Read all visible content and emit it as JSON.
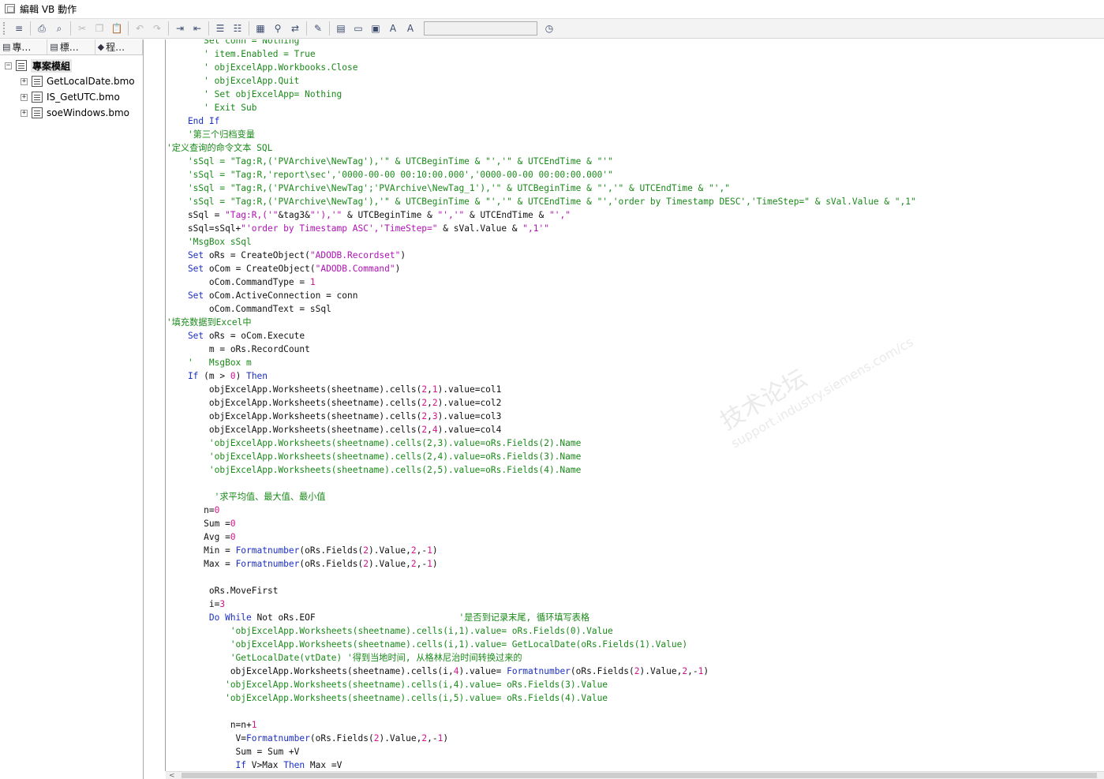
{
  "window": {
    "title": "編輯 VB 動作"
  },
  "toolbar": {
    "buttons": [
      {
        "name": "format-button",
        "icon": "≡"
      },
      {
        "name": "print-button",
        "icon": "⎙"
      },
      {
        "name": "print-preview-button",
        "icon": "⌕"
      },
      {
        "name": "cut-button",
        "icon": "✂"
      },
      {
        "name": "copy-button",
        "icon": "❐"
      },
      {
        "name": "paste-button",
        "icon": "📋"
      },
      {
        "name": "undo-button",
        "icon": "↶"
      },
      {
        "name": "redo-button",
        "icon": "↷"
      },
      {
        "name": "indent-button",
        "icon": "⇥"
      },
      {
        "name": "outdent-button",
        "icon": "⇤"
      },
      {
        "name": "comment-button",
        "icon": "☰"
      },
      {
        "name": "uncomment-button",
        "icon": "☷"
      },
      {
        "name": "bookmark-button",
        "icon": "▦"
      },
      {
        "name": "find-button",
        "icon": "⚲"
      },
      {
        "name": "replace-button",
        "icon": "⇄"
      },
      {
        "name": "breakpoint-button",
        "icon": "✎"
      },
      {
        "name": "compile-button",
        "icon": "▤"
      },
      {
        "name": "open-folder-button",
        "icon": "▭"
      },
      {
        "name": "new-folder-button",
        "icon": "▣"
      },
      {
        "name": "font-button",
        "icon": "A"
      },
      {
        "name": "text-button",
        "icon": "A"
      },
      {
        "name": "clock-button",
        "icon": "◷"
      }
    ]
  },
  "sidebar": {
    "tabs": [
      {
        "label": "專…",
        "icon": "▤"
      },
      {
        "label": "標…",
        "icon": "▤"
      },
      {
        "label": "程…",
        "icon": "◆"
      }
    ],
    "root": "專案模組",
    "items": [
      "GetLocalDate.bmo",
      "IS_GetUTC.bmo",
      "soeWindows.bmo"
    ]
  },
  "editor": {
    "lines": [
      [
        [
          "cm",
          "       Set conn = Nothing"
        ]
      ],
      [
        [
          "cm",
          "       ' item.Enabled = True"
        ]
      ],
      [
        [
          "cm",
          "       ' objExcelApp.Workbooks.Close"
        ]
      ],
      [
        [
          "cm",
          "       ' objExcelApp.Quit"
        ]
      ],
      [
        [
          "cm",
          "       ' Set objExcelApp= Nothing"
        ]
      ],
      [
        [
          "cm",
          "       ' Exit Sub"
        ]
      ],
      [
        [
          "kw",
          "    End If"
        ]
      ],
      [
        [
          "cm",
          "    '第三个归档变量"
        ]
      ],
      [
        [
          "cm",
          "'定义查询的命令文本 SQL"
        ]
      ],
      [
        [
          "cm",
          "    'sSql = \"Tag:R,('PVArchive\\NewTag'),'\" & UTCBeginTime & \"','\" & UTCEndTime & \"'\""
        ]
      ],
      [
        [
          "cm",
          "    'sSql = \"Tag:R,'report\\sec','0000-00-00 00:10:00.000','0000-00-00 00:00:00.000'\""
        ]
      ],
      [
        [
          "cm",
          "    'sSql = \"Tag:R,('PVArchive\\NewTag';'PVArchive\\NewTag_1'),'\" & UTCBeginTime & \"','\" & UTCEndTime & \"',\""
        ]
      ],
      [
        [
          "cm",
          "    'sSql = \"Tag:R,('PVArchive\\NewTag'),'\" & UTCBeginTime & \"','\" & UTCEndTime & \"','order by Timestamp DESC','TimeStep=\" & sVal.Value & \",1\""
        ]
      ],
      [
        [
          "id",
          "    sSql = "
        ],
        [
          "str",
          "\"Tag:R,('\""
        ],
        [
          "id",
          "&tag3&"
        ],
        [
          "str",
          "\"'),'\""
        ],
        [
          "id",
          " & UTCBeginTime & "
        ],
        [
          "str",
          "\"','\""
        ],
        [
          "id",
          " & UTCEndTime & "
        ],
        [
          "str",
          "\"',\""
        ]
      ],
      [
        [
          "id",
          "    sSql=sSql+"
        ],
        [
          "str",
          "\"'order by Timestamp ASC','TimeStep=\""
        ],
        [
          "id",
          " & sVal.Value & "
        ],
        [
          "str",
          "\",1'\""
        ]
      ],
      [
        [
          "cm",
          "    'MsgBox sSql"
        ]
      ],
      [
        [
          "kw",
          "    Set"
        ],
        [
          "id",
          " oRs = CreateObject("
        ],
        [
          "str",
          "\"ADODB.Recordset\""
        ],
        [
          "id",
          ")"
        ]
      ],
      [
        [
          "kw",
          "    Set"
        ],
        [
          "id",
          " oCom = CreateObject("
        ],
        [
          "str",
          "\"ADODB.Command\""
        ],
        [
          "id",
          ")"
        ]
      ],
      [
        [
          "id",
          "        oCom.CommandType = "
        ],
        [
          "num",
          "1"
        ]
      ],
      [
        [
          "kw",
          "    Set"
        ],
        [
          "id",
          " oCom.ActiveConnection = conn"
        ]
      ],
      [
        [
          "id",
          "        oCom.CommandText = sSql"
        ]
      ],
      [
        [
          "cm",
          "'填充数据到Excel中"
        ]
      ],
      [
        [
          "kw",
          "    Set"
        ],
        [
          "id",
          " oRs = oCom.Execute"
        ]
      ],
      [
        [
          "id",
          "        m = oRs.RecordCount"
        ]
      ],
      [
        [
          "cm",
          "    '   MsgBox m"
        ]
      ],
      [
        [
          "kw",
          "    If"
        ],
        [
          "id",
          " (m > "
        ],
        [
          "num",
          "0"
        ],
        [
          "id",
          ") "
        ],
        [
          "kw",
          "Then"
        ]
      ],
      [
        [
          "id",
          "        objExcelApp.Worksheets(sheetname).cells("
        ],
        [
          "num",
          "2"
        ],
        [
          "id",
          ","
        ],
        [
          "num",
          "1"
        ],
        [
          "id",
          ").value=col1"
        ]
      ],
      [
        [
          "id",
          "        objExcelApp.Worksheets(sheetname).cells("
        ],
        [
          "num",
          "2"
        ],
        [
          "id",
          ","
        ],
        [
          "num",
          "2"
        ],
        [
          "id",
          ").value=col2"
        ]
      ],
      [
        [
          "id",
          "        objExcelApp.Worksheets(sheetname).cells("
        ],
        [
          "num",
          "2"
        ],
        [
          "id",
          ","
        ],
        [
          "num",
          "3"
        ],
        [
          "id",
          ").value=col3"
        ]
      ],
      [
        [
          "id",
          "        objExcelApp.Worksheets(sheetname).cells("
        ],
        [
          "num",
          "2"
        ],
        [
          "id",
          ","
        ],
        [
          "num",
          "4"
        ],
        [
          "id",
          ").value=col4"
        ]
      ],
      [
        [
          "cm",
          "        'objExcelApp.Worksheets(sheetname).cells(2,3).value=oRs.Fields(2).Name"
        ]
      ],
      [
        [
          "cm",
          "        'objExcelApp.Worksheets(sheetname).cells(2,4).value=oRs.Fields(3).Name"
        ]
      ],
      [
        [
          "cm",
          "        'objExcelApp.Worksheets(sheetname).cells(2,5).value=oRs.Fields(4).Name"
        ]
      ],
      [
        [
          "id",
          ""
        ]
      ],
      [
        [
          "cm",
          "         '求平均值、最大值、最小值"
        ]
      ],
      [
        [
          "id",
          "       n="
        ],
        [
          "num",
          "0"
        ]
      ],
      [
        [
          "id",
          "       Sum ="
        ],
        [
          "num",
          "0"
        ]
      ],
      [
        [
          "id",
          "       Avg ="
        ],
        [
          "num",
          "0"
        ]
      ],
      [
        [
          "id",
          "       Min = "
        ],
        [
          "kw",
          "Formatnumber"
        ],
        [
          "id",
          "(oRs.Fields("
        ],
        [
          "num",
          "2"
        ],
        [
          "id",
          ").Value,"
        ],
        [
          "num",
          "2"
        ],
        [
          "id",
          ",-"
        ],
        [
          "num",
          "1"
        ],
        [
          "id",
          ")"
        ]
      ],
      [
        [
          "id",
          "       Max = "
        ],
        [
          "kw",
          "Formatnumber"
        ],
        [
          "id",
          "(oRs.Fields("
        ],
        [
          "num",
          "2"
        ],
        [
          "id",
          ").Value,"
        ],
        [
          "num",
          "2"
        ],
        [
          "id",
          ",-"
        ],
        [
          "num",
          "1"
        ],
        [
          "id",
          ")"
        ]
      ],
      [
        [
          "id",
          ""
        ]
      ],
      [
        [
          "id",
          "        oRs.MoveFirst"
        ]
      ],
      [
        [
          "id",
          "        i="
        ],
        [
          "num",
          "3"
        ]
      ],
      [
        [
          "kw",
          "        Do While"
        ],
        [
          "id",
          " Not oRs.EOF                           "
        ],
        [
          "cm",
          "'是否到记录末尾, 循环填写表格"
        ]
      ],
      [
        [
          "cm",
          "            'objExcelApp.Worksheets(sheetname).cells(i,1).value= oRs.Fields(0).Value"
        ]
      ],
      [
        [
          "cm",
          "            'objExcelApp.Worksheets(sheetname).cells(i,1).value= GetLocalDate(oRs.Fields(1).Value)"
        ]
      ],
      [
        [
          "cm",
          "            'GetLocalDate(vtDate) '得到当地时间, 从格林尼治时间转换过来的"
        ]
      ],
      [
        [
          "id",
          "            objExcelApp.Worksheets(sheetname).cells(i,"
        ],
        [
          "num",
          "4"
        ],
        [
          "id",
          ").value= "
        ],
        [
          "kw",
          "Formatnumber"
        ],
        [
          "id",
          "(oRs.Fields("
        ],
        [
          "num",
          "2"
        ],
        [
          "id",
          ").Value,"
        ],
        [
          "num",
          "2"
        ],
        [
          "id",
          ",-"
        ],
        [
          "num",
          "1"
        ],
        [
          "id",
          ")"
        ]
      ],
      [
        [
          "cm",
          "           'objExcelApp.Worksheets(sheetname).cells(i,4).value= oRs.Fields(3).Value"
        ]
      ],
      [
        [
          "cm",
          "           'objExcelApp.Worksheets(sheetname).cells(i,5).value= oRs.Fields(4).Value"
        ]
      ],
      [
        [
          "id",
          ""
        ]
      ],
      [
        [
          "id",
          "            n=n+"
        ],
        [
          "num",
          "1"
        ]
      ],
      [
        [
          "id",
          "             V="
        ],
        [
          "kw",
          "Formatnumber"
        ],
        [
          "id",
          "(oRs.Fields("
        ],
        [
          "num",
          "2"
        ],
        [
          "id",
          ").Value,"
        ],
        [
          "num",
          "2"
        ],
        [
          "id",
          ",-"
        ],
        [
          "num",
          "1"
        ],
        [
          "id",
          ")"
        ]
      ],
      [
        [
          "id",
          "             Sum = Sum +V"
        ]
      ],
      [
        [
          "kw",
          "             If"
        ],
        [
          "id",
          " V>Max "
        ],
        [
          "kw",
          "Then"
        ],
        [
          "id",
          " Max =V"
        ]
      ]
    ]
  },
  "watermark": {
    "main": "技术论坛",
    "sub": "support.industry.siemens.com/cs"
  }
}
